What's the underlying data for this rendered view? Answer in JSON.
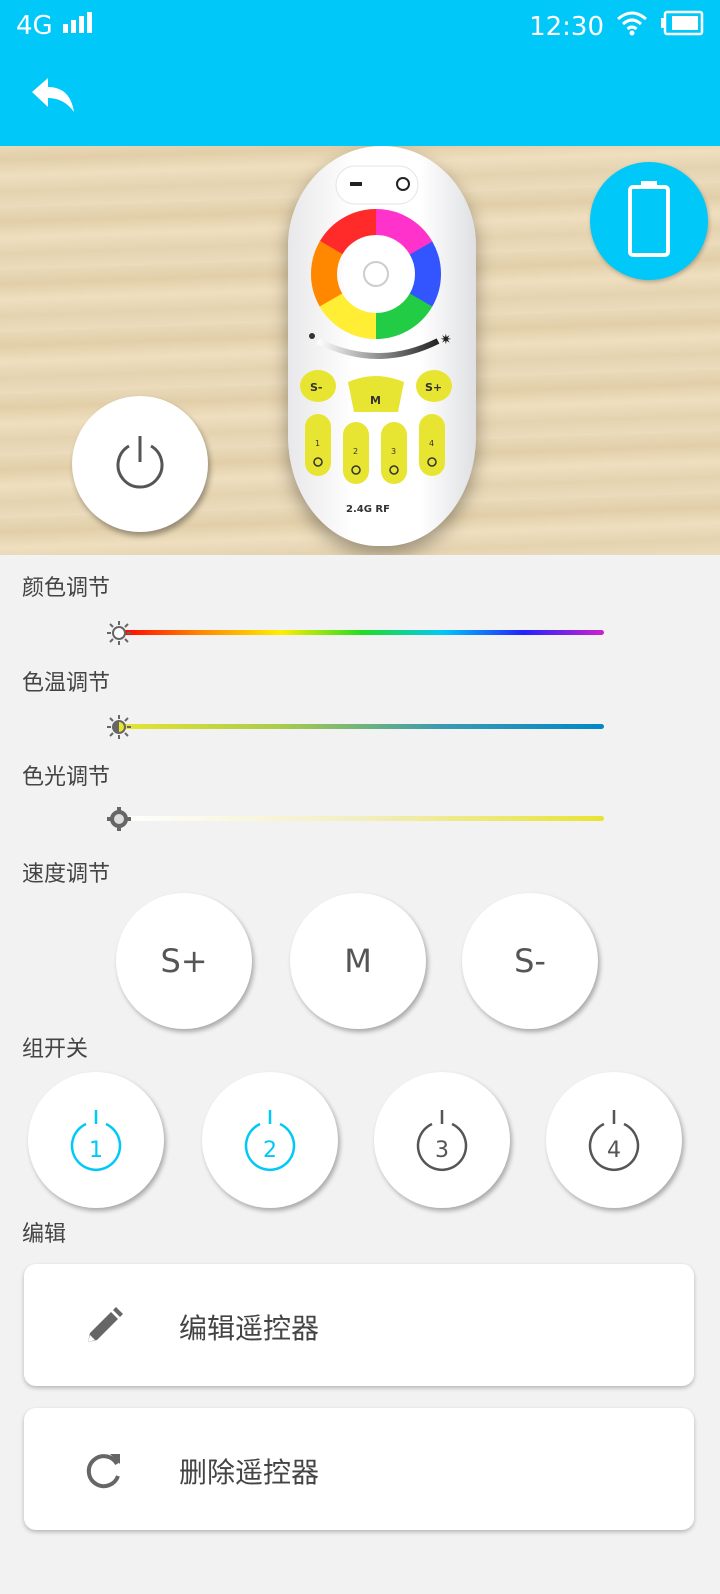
{
  "status_bar": {
    "network": "4G",
    "time": "12:30"
  },
  "labels": {
    "color_adjust": "颜色调节",
    "color_temp_adjust": "色温调节",
    "color_light_adjust": "色光调节",
    "speed_adjust": "速度调节",
    "group_switch": "组开关",
    "edit": "编辑"
  },
  "speed_buttons": [
    "S+",
    "M",
    "S-"
  ],
  "group_buttons": [
    {
      "label": "1",
      "active": true
    },
    {
      "label": "2",
      "active": true
    },
    {
      "label": "3",
      "active": false
    },
    {
      "label": "4",
      "active": false
    }
  ],
  "actions": {
    "edit_remote": "编辑遥控器",
    "delete_remote": "删除遥控器"
  },
  "remote_image": {
    "speed_buttons": [
      "S-",
      "M",
      "S+"
    ],
    "groups": [
      "1",
      "2",
      "3",
      "4"
    ],
    "brand_text": "2.4G RF"
  },
  "colors": {
    "accent": "#00c8f8",
    "active_group": "#00c8f8",
    "inactive_group": "#555555"
  }
}
